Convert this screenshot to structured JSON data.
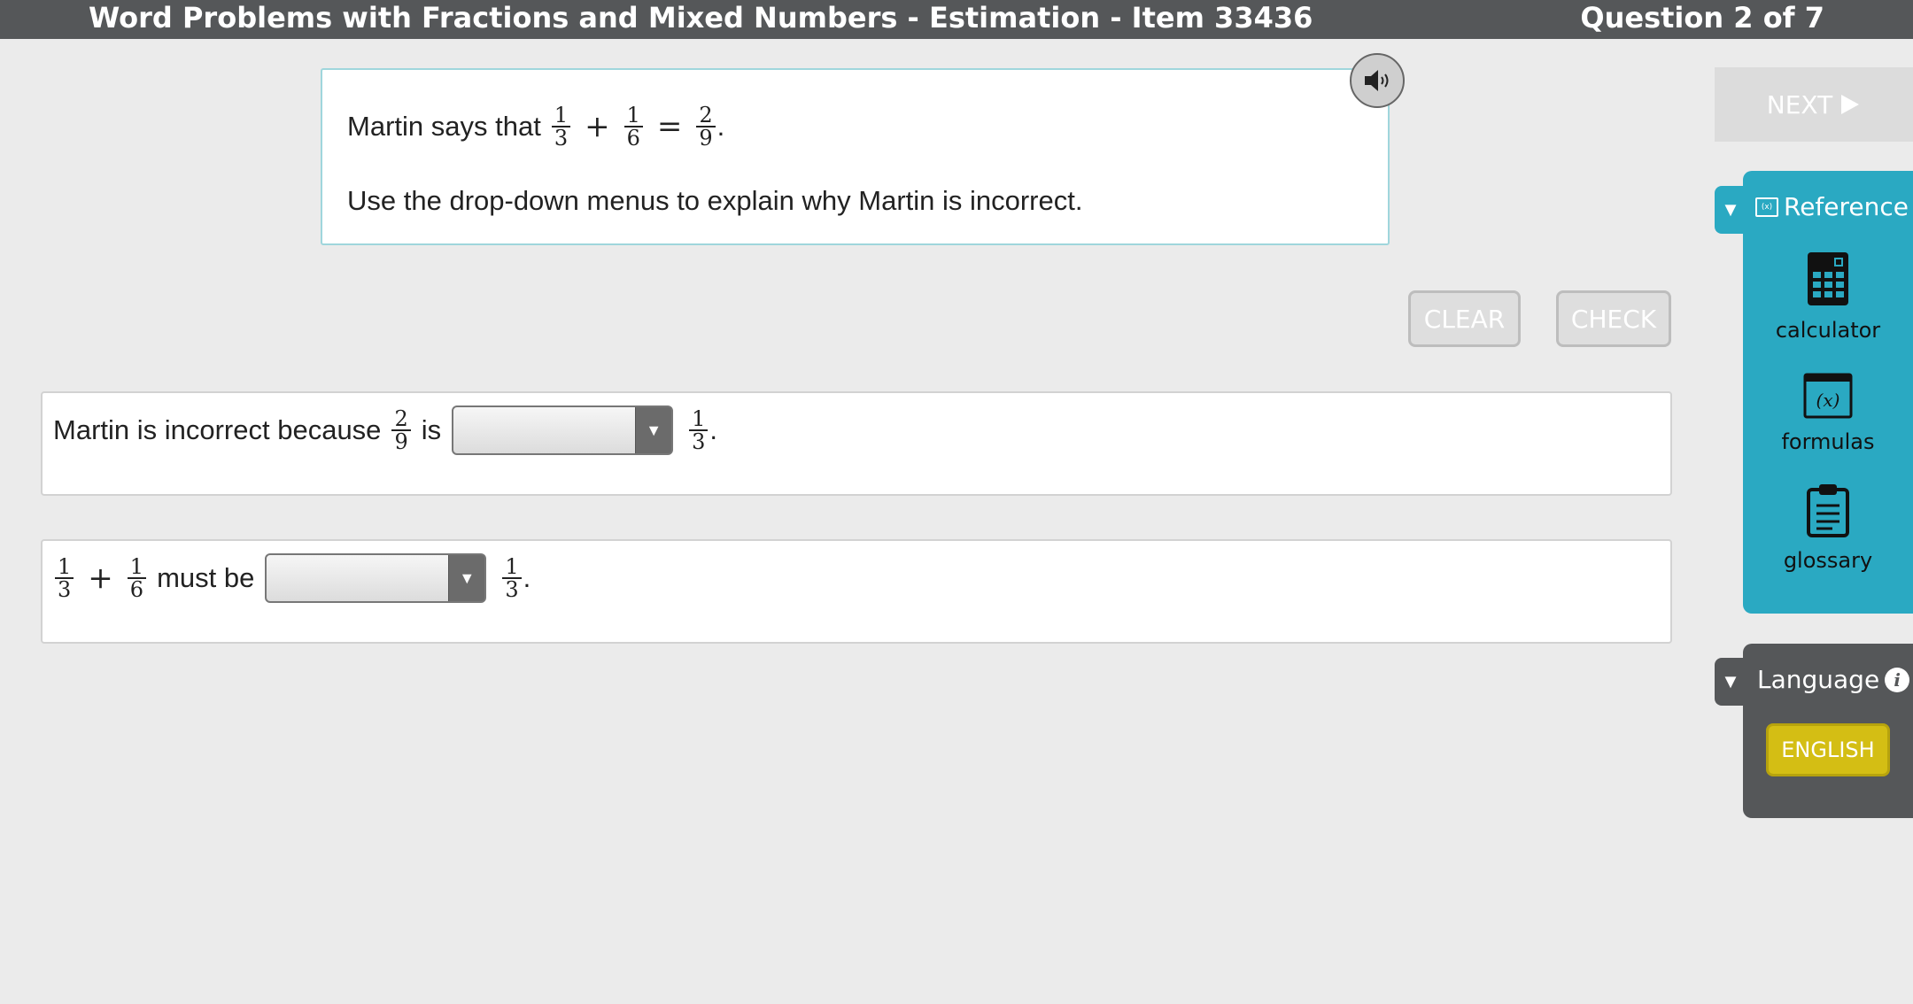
{
  "header": {
    "title": "Word Problems with Fractions and Mixed Numbers - Estimation - Item 33436",
    "question_counter": "Question 2 of 7"
  },
  "prompt": {
    "intro": "Martin says that",
    "equation": {
      "frac_a": {
        "num": "1",
        "den": "3"
      },
      "op1": "+",
      "frac_b": {
        "num": "1",
        "den": "6"
      },
      "op2": "=",
      "frac_c": {
        "num": "2",
        "den": "9"
      },
      "end": "."
    },
    "instruction": "Use the drop-down menus to explain why Martin is incorrect."
  },
  "buttons": {
    "clear": "CLEAR",
    "check": "CHECK",
    "next": "NEXT"
  },
  "answers": {
    "row1": {
      "prefix": "Martin is incorrect because",
      "frac_left": {
        "num": "2",
        "den": "9"
      },
      "word": "is",
      "dropdown_value": "",
      "frac_right": {
        "num": "1",
        "den": "3"
      },
      "end": "."
    },
    "row2": {
      "frac_a": {
        "num": "1",
        "den": "3"
      },
      "op": "+",
      "frac_b": {
        "num": "1",
        "den": "6"
      },
      "word": "must be",
      "dropdown_value": "",
      "frac_right": {
        "num": "1",
        "den": "3"
      },
      "end": "."
    }
  },
  "reference_panel": {
    "title": "Reference",
    "tools": [
      "calculator",
      "formulas",
      "glossary"
    ]
  },
  "language_panel": {
    "title": "Language",
    "button": "ENGLISH"
  },
  "icons": {
    "audio": "speaker-icon",
    "next": "play-triangle-icon",
    "calculator": "calculator-icon",
    "formulas": "formula-icon",
    "glossary": "clipboard-icon",
    "info": "info-icon"
  },
  "colors": {
    "topbar": "#555759",
    "reference_panel": "#2aa9c2",
    "language_panel": "#555759",
    "english_button": "#d4be14"
  }
}
